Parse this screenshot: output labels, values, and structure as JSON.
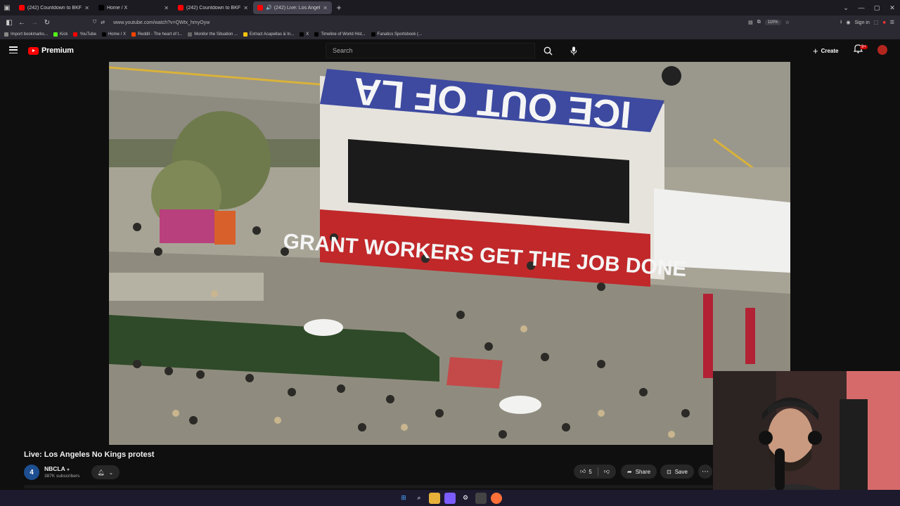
{
  "browser": {
    "tabs": [
      {
        "title": "(242) Countdown to BKFC FIGH",
        "favicon_color": "#ff0000",
        "active": false
      },
      {
        "title": "Home / X",
        "favicon_color": "#000000",
        "active": false
      },
      {
        "title": "(242) Countdown to BKFC FIGH",
        "favicon_color": "#ff0000",
        "active": false
      },
      {
        "title": "(242) Live: Los Angeles No K",
        "favicon_color": "#ff0000",
        "active": true
      }
    ],
    "url": "www.youtube.com/watch?v=QWtx_hmyOyw",
    "zoom": "110%",
    "bookmarks": [
      {
        "label": "Import bookmarks...",
        "color": "#888888"
      },
      {
        "label": "Kick",
        "color": "#53fc18"
      },
      {
        "label": "YouTube",
        "color": "#ff0000"
      },
      {
        "label": "Home / X",
        "color": "#000000"
      },
      {
        "label": "Reddit - The heart of t...",
        "color": "#ff4500"
      },
      {
        "label": "Monitor the Situation ...",
        "color": "#666666"
      },
      {
        "label": "Extract Acapellas & In...",
        "color": "#f4c20d"
      },
      {
        "label": "X",
        "color": "#000000"
      },
      {
        "label": "Timeline of World Hist...",
        "color": "#000000"
      },
      {
        "label": "Fanatics Sportsbook (...",
        "color": "#000000"
      }
    ],
    "signin": "Sign in"
  },
  "youtube": {
    "brand": "Premium",
    "search_placeholder": "Search",
    "create_label": "Create",
    "notif_badge": "9+"
  },
  "video": {
    "title": "Live: Los Angeles No Kings protest",
    "banner_top_text": "ICE OUT OF LA",
    "banner_side_text": "GRANT WORKERS GET THE JOB DONE",
    "channel": {
      "name": "NBCLA",
      "logo_text": "4",
      "subscribers": "387K subscribers"
    },
    "likes": "5",
    "share_label": "Share",
    "save_label": "Save"
  },
  "colors": {
    "yt_red": "#ff0000",
    "bg": "#0f0f0f",
    "pill": "#272727"
  }
}
